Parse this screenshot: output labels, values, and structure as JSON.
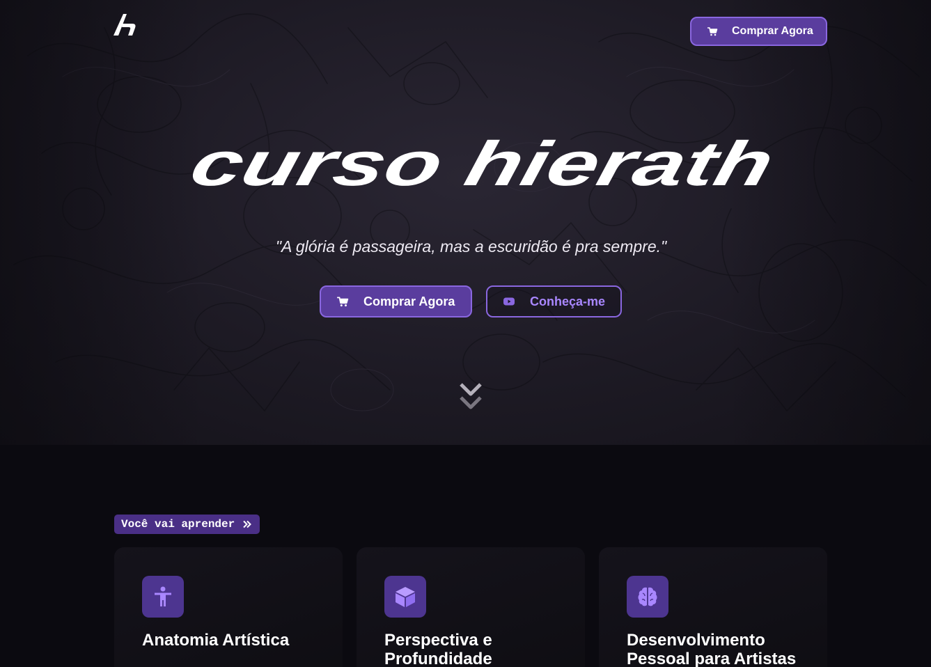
{
  "brand": {
    "logo": "hierath-logo",
    "accent": "#8a67e0",
    "accent_dark": "#5a3d9e"
  },
  "nav": {
    "buy_label": "Comprar Agora",
    "buy_icon": "cart-icon"
  },
  "hero": {
    "title": "curso hierath",
    "quote": "\"A glória é passageira, mas a escuridão é pra sempre.\"",
    "buy_label": "Comprar Agora",
    "buy_icon": "cart-icon",
    "know_label": "Conheça-me",
    "know_icon": "youtube-icon",
    "scroll_icon": "double-chevron-down-icon"
  },
  "learn": {
    "tag_label": "Você vai aprender",
    "tag_icon": "double-chevron-right-icon",
    "cards": [
      {
        "title": "Anatomia Artística",
        "icon": "human-figure-icon"
      },
      {
        "title": "Perspectiva e Profundidade",
        "icon": "cube-icon"
      },
      {
        "title": "Desenvolvimento Pessoal para Artistas",
        "icon": "brain-icon"
      }
    ]
  }
}
